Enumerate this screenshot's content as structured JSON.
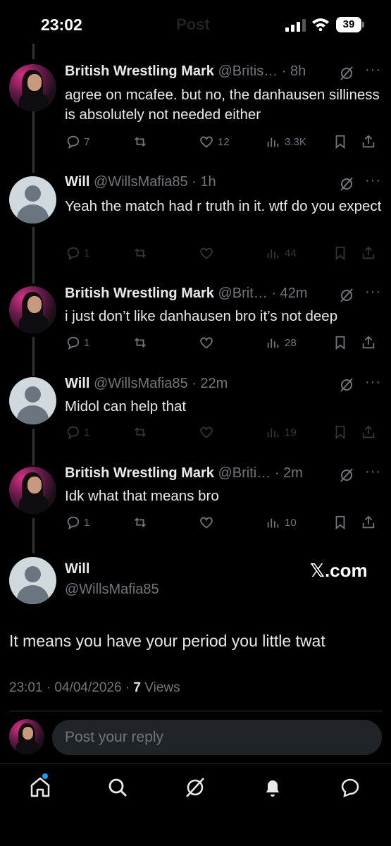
{
  "status_bar": {
    "time": "23:02",
    "ghost_title": "Post",
    "battery": "39"
  },
  "tweets": [
    {
      "name": "British Wrestling Mark",
      "handle": "@Britis…",
      "time": "· 8h",
      "text": "agree on mcafee. but no, the danhausen silliness is absolutely not needed either",
      "replies": "7",
      "reposts": "",
      "likes": "12",
      "views": "3.3K"
    },
    {
      "name": "Will",
      "handle": "@WillsMafia85",
      "time": "· 1h",
      "text": "Yeah the match had r truth in it.  wtf do you expect",
      "replies": "1",
      "reposts": "",
      "likes": "",
      "views": "44"
    },
    {
      "name": "British Wrestling Mark",
      "handle": "@Brit…",
      "time": "· 42m",
      "text": "i just don’t like danhausen bro it’s not deep",
      "replies": "1",
      "reposts": "",
      "likes": "",
      "views": "28"
    },
    {
      "name": "Will",
      "handle": "@WillsMafia85",
      "time": "· 22m",
      "text": "Midol can help that",
      "replies": "1",
      "reposts": "",
      "likes": "",
      "views": "19"
    },
    {
      "name": "British Wrestling Mark",
      "handle": "@Briti…",
      "time": "· 2m",
      "text": "Idk what that means bro",
      "replies": "1",
      "reposts": "",
      "likes": "",
      "views": "10"
    }
  ],
  "main_tweet": {
    "name": "Will",
    "handle": "@WillsMafia85",
    "watermark": "𝕏.com",
    "text": "It means you have your period you little twat",
    "timestamp": "23:01 · 04/04/2026 · ",
    "views_count": "7",
    "views_label": " Views"
  },
  "reply_bar": {
    "placeholder": "Post your reply"
  },
  "icons": {
    "reply": "reply-icon",
    "repost": "repost-icon",
    "like": "heart-icon",
    "views": "views-icon",
    "bookmark": "bookmark-icon",
    "share": "share-icon",
    "grok": "grok-icon",
    "more": "more-icon"
  },
  "colors": {
    "background": "#000000",
    "text": "#e7e9ea",
    "secondary": "#71767b",
    "accent": "#1d9bf0"
  }
}
